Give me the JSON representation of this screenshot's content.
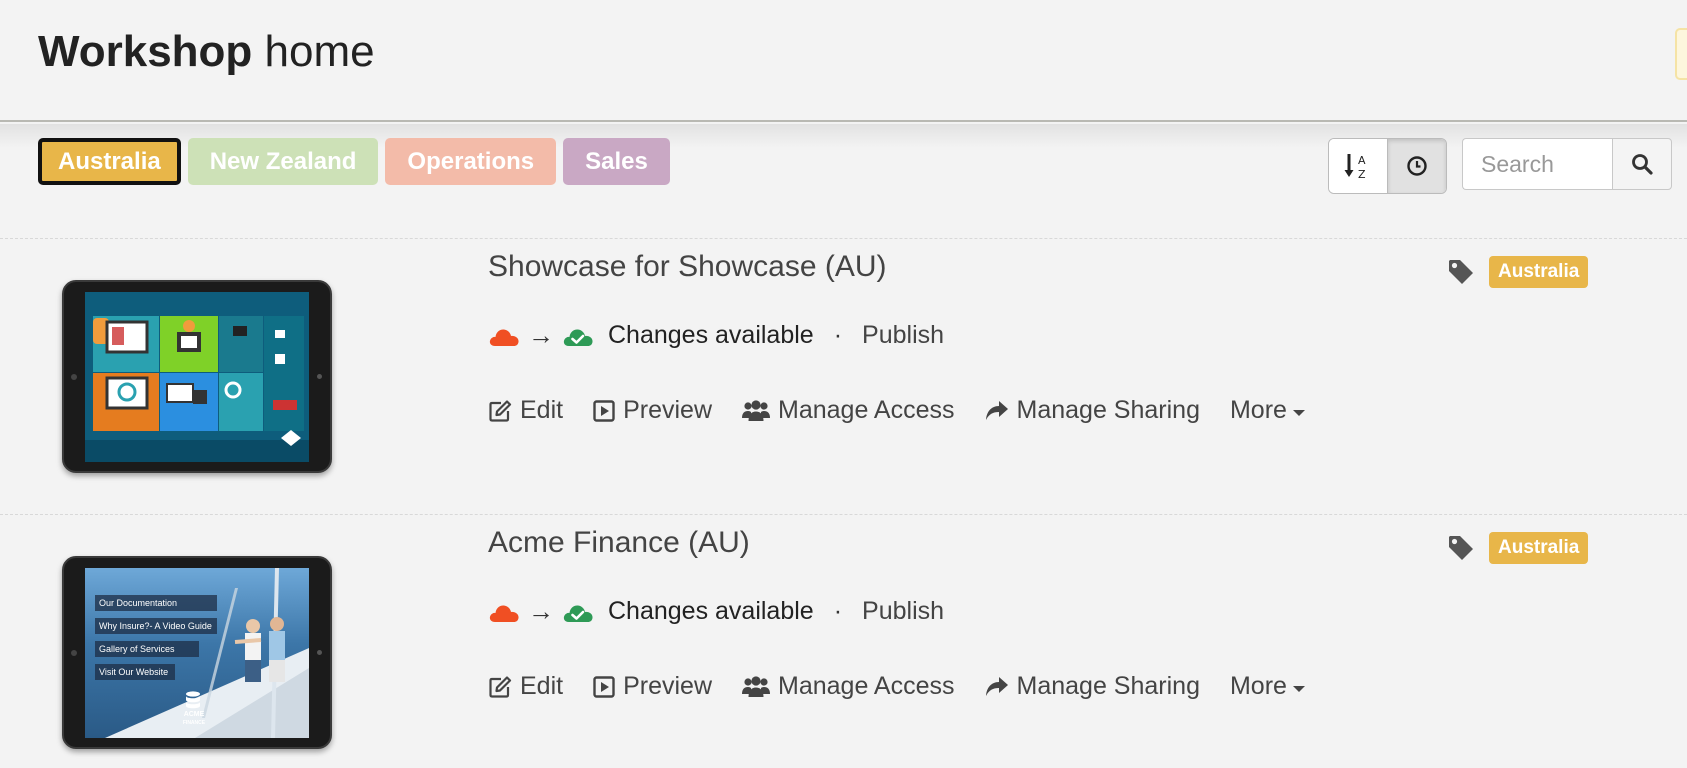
{
  "header": {
    "title_strong": "Workshop",
    "title_light": "home"
  },
  "filters": [
    {
      "label": "Australia",
      "color": "#e8b649",
      "selected": true
    },
    {
      "label": "New Zealand",
      "color": "#cde1b7",
      "selected": false
    },
    {
      "label": "Operations",
      "color": "#f3bba9",
      "selected": false
    },
    {
      "label": "Sales",
      "color": "#c9a8c4",
      "selected": false
    }
  ],
  "sort": {
    "options": [
      "alphabetical-sort-icon",
      "clock-icon"
    ],
    "active": "clock-icon"
  },
  "search": {
    "placeholder": "Search",
    "value": ""
  },
  "colors": {
    "cloud_source": "#f04f23",
    "cloud_target": "#2e9a56",
    "tag": "#e8b649"
  },
  "items": [
    {
      "title": "Showcase for Showcase (AU)",
      "status": "Changes available",
      "publish_label": "Publish",
      "tag": "Australia",
      "actions": {
        "edit": "Edit",
        "preview": "Preview",
        "manage_access": "Manage Access",
        "manage_sharing": "Manage Sharing",
        "more": "More"
      }
    },
    {
      "title": "Acme Finance (AU)",
      "status": "Changes available",
      "publish_label": "Publish",
      "tag": "Australia",
      "thumbnail_menu": [
        "Our Documentation",
        "Why Insure?- A Video Guide",
        "Gallery of Services",
        "Visit Our Website"
      ],
      "thumbnail_logo": "ACME",
      "thumbnail_logo_sub": "FINANCE",
      "actions": {
        "edit": "Edit",
        "preview": "Preview",
        "manage_access": "Manage Access",
        "manage_sharing": "Manage Sharing",
        "more": "More"
      }
    }
  ]
}
